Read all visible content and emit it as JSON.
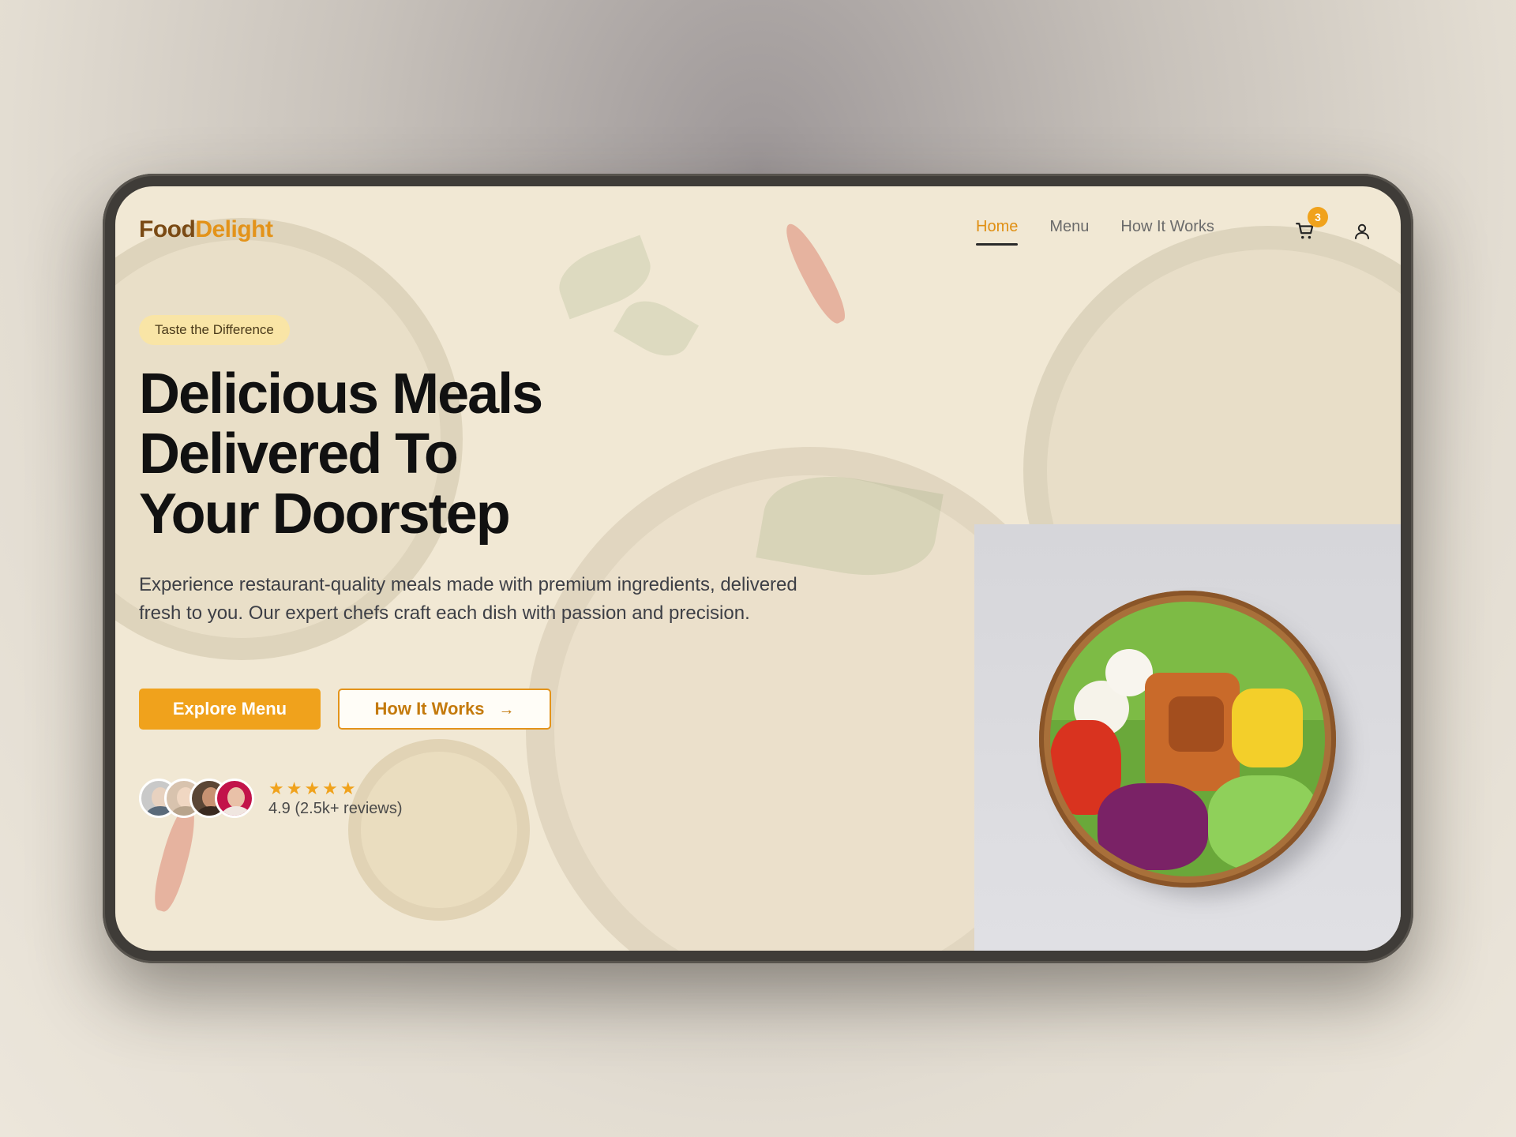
{
  "brand": {
    "part1": "Food",
    "part2": "Delight"
  },
  "nav": {
    "links": [
      {
        "label": "Home",
        "active": true
      },
      {
        "label": "Menu",
        "active": false
      },
      {
        "label": "How It Works",
        "active": false
      }
    ],
    "cart_count": "3",
    "cart_icon": "shopping-cart-icon",
    "user_icon": "user-icon"
  },
  "hero": {
    "tag": "Taste the Difference",
    "headline": [
      "Delicious Meals",
      "Delivered To",
      "Your Doorstep"
    ],
    "description": "Experience restaurant-quality meals made with premium ingredients, delivered fresh to you. Our expert chefs craft each dish with passion and precision.",
    "primary_button": "Explore Menu",
    "secondary_button": "How It Works",
    "secondary_icon": "arrow-right-icon",
    "stars": "★★★★★",
    "rating_text": "4.9 (2.5k+ reviews)",
    "rating_value": 4.9
  },
  "colors": {
    "accent": "#f0a21c",
    "brand_dark": "#7a4a14",
    "background": "#f1e8d4",
    "text": "#111111"
  }
}
